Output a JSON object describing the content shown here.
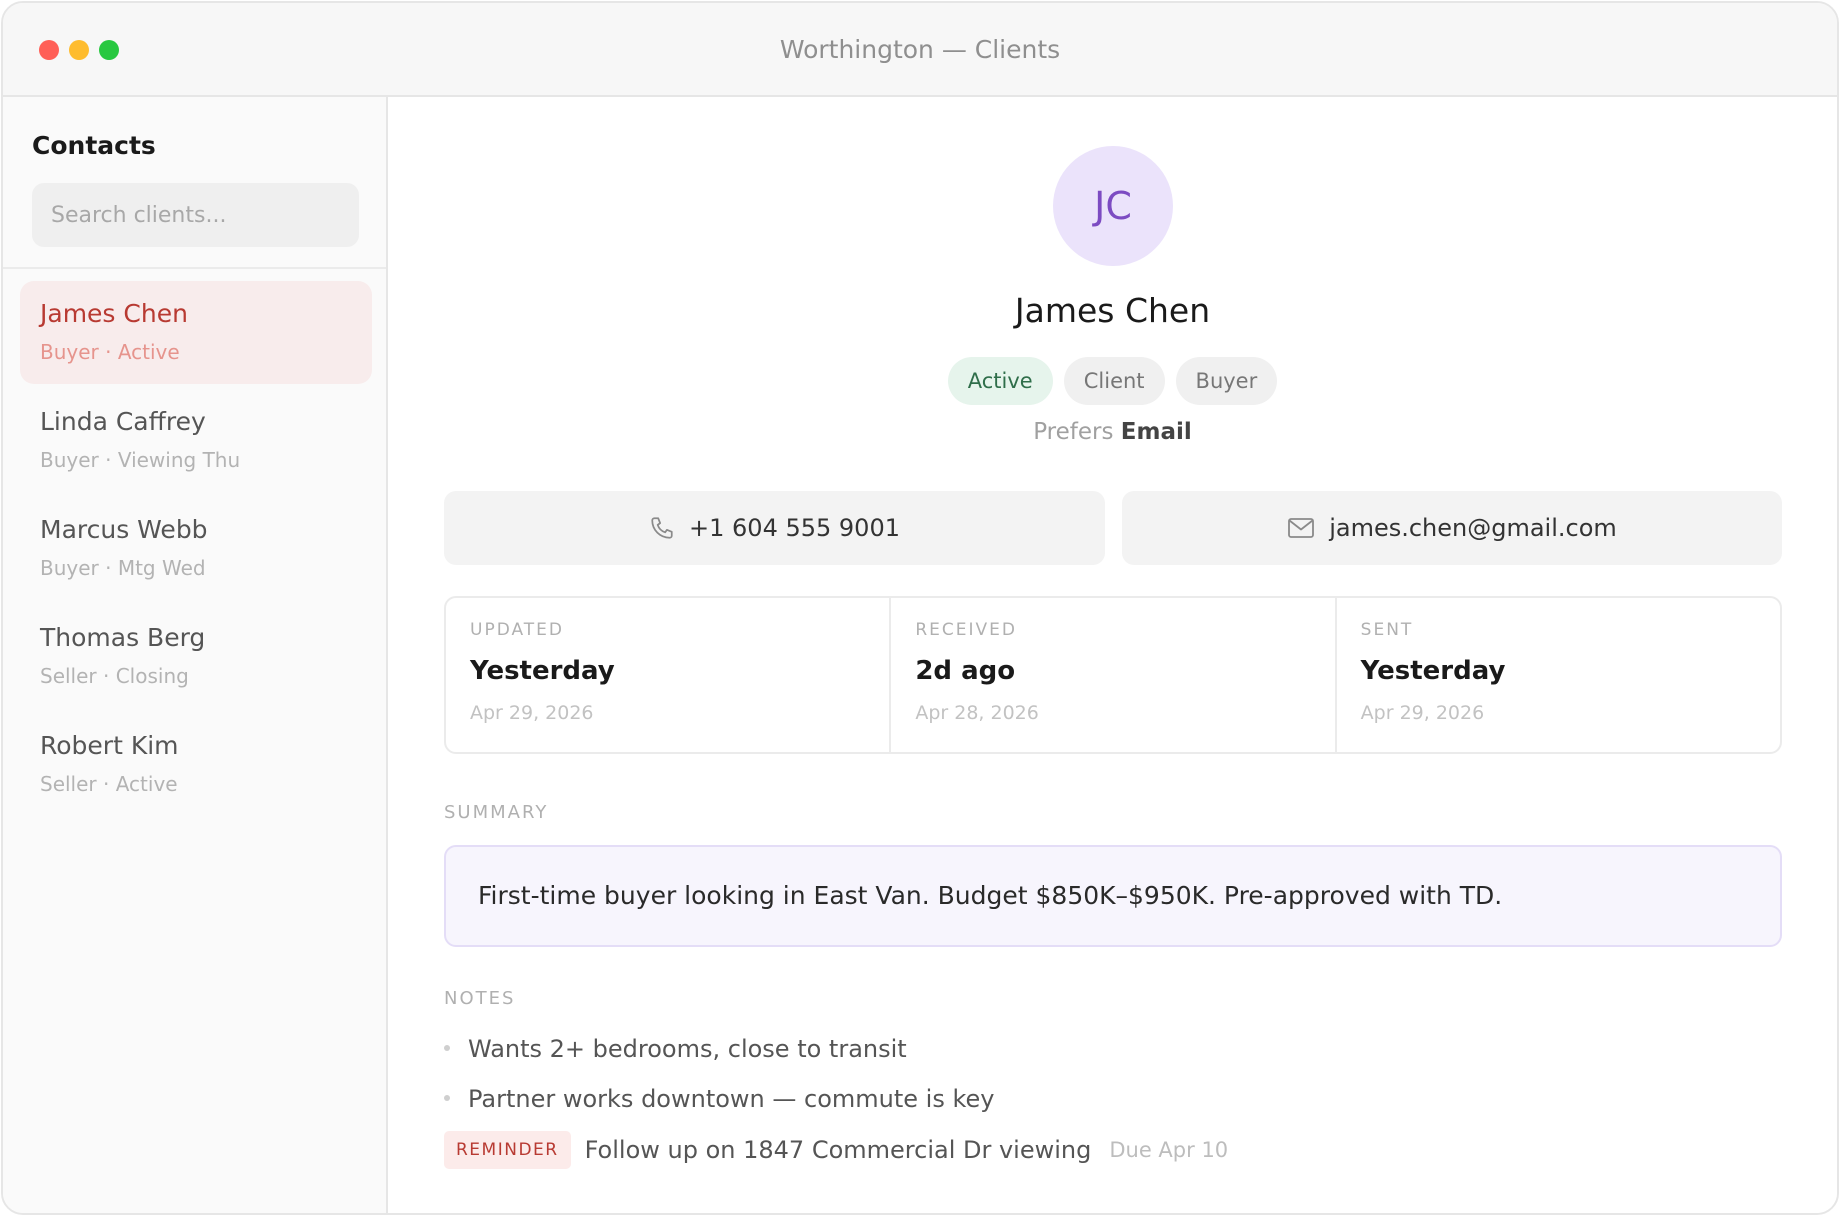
{
  "window": {
    "title": "Worthington — Clients",
    "controls": {
      "close_color": "#ff5f57",
      "minimize_color": "#febc2e",
      "zoom_color": "#28c840"
    }
  },
  "sidebar": {
    "heading": "Contacts",
    "search_placeholder": "Search clients...",
    "contacts": [
      {
        "name": "James Chen",
        "subtitle": "Buyer · Active",
        "selected": true
      },
      {
        "name": "Linda Caffrey",
        "subtitle": "Buyer · Viewing Thu"
      },
      {
        "name": "Marcus Webb",
        "subtitle": "Buyer · Mtg Wed"
      },
      {
        "name": "Thomas Berg",
        "subtitle": "Seller · Closing"
      },
      {
        "name": "Robert Kim",
        "subtitle": "Seller · Active"
      }
    ]
  },
  "client": {
    "initials": "JC",
    "name": "James Chen",
    "tags": [
      "Active",
      "Client",
      "Buyer"
    ],
    "prefers_label": "Prefers",
    "prefers_value": "Email",
    "phone": "+1 604 555 9001",
    "email": "james.chen@gmail.com",
    "phone_icon": "phone-icon",
    "email_icon": "mail-icon"
  },
  "stats": [
    {
      "label": "UPDATED",
      "value": "Yesterday",
      "date": "Apr 29, 2026"
    },
    {
      "label": "RECEIVED",
      "value": "2d ago",
      "date": "Apr 28, 2026"
    },
    {
      "label": "SENT",
      "value": "Yesterday",
      "date": "Apr 29, 2026"
    }
  ],
  "summary": {
    "label": "SUMMARY",
    "text": "First-time buyer looking in East Van. Budget $850K–$950K. Pre-approved with TD."
  },
  "notes": {
    "label": "NOTES",
    "items": [
      "Wants 2+ bedrooms, close to transit",
      "Partner works downtown — commute is key"
    ],
    "reminder": {
      "badge": "REMINDER",
      "text": "Follow up on 1847 Commercial Dr viewing",
      "due": "Due Apr 10"
    }
  },
  "colors": {
    "selected_bg": "#f8ecec",
    "selected_text": "#b83a32",
    "avatar_bg": "#ebe3fb",
    "avatar_text": "#7c4bc2",
    "active_tag_bg": "#e6f4ec",
    "active_tag_text": "#2f6e4a",
    "summary_bg": "#f7f5fd",
    "reminder_bg": "#fcebea"
  }
}
